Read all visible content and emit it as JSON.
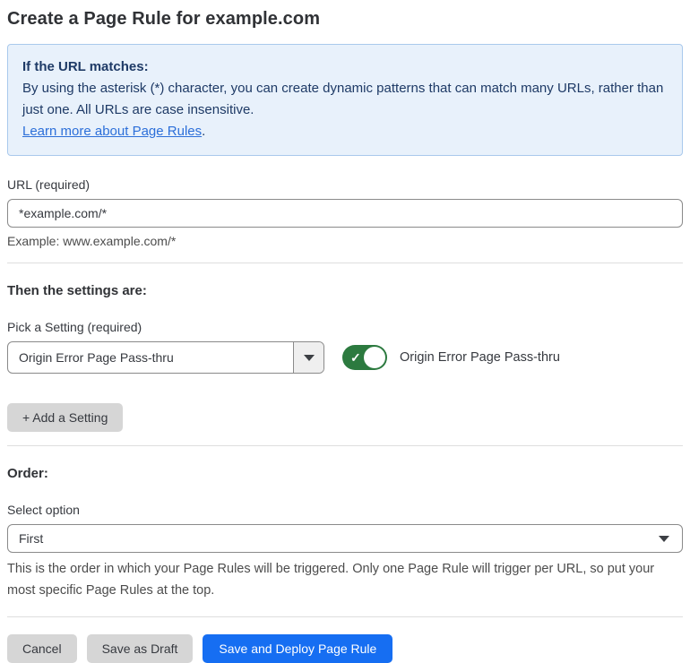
{
  "page": {
    "title": "Create a Page Rule for example.com"
  },
  "info_box": {
    "heading": "If the URL matches:",
    "body": "By using the asterisk (*) character, you can create dynamic patterns that can match many URLs, rather than just one. All URLs are case insensitive.",
    "link_label": "Learn more about Page Rules",
    "link_suffix": "."
  },
  "url_field": {
    "label": "URL (required)",
    "value": "*example.com/*",
    "example": "Example: www.example.com/*"
  },
  "settings_section": {
    "heading": "Then the settings are:",
    "picker_label": "Pick a Setting (required)",
    "picker_value": "Origin Error Page Pass-thru",
    "toggle_state": "on",
    "toggle_check": "✓",
    "toggle_label": "Origin Error Page Pass-thru",
    "add_setting_label": "+ Add a Setting"
  },
  "order_section": {
    "heading": "Order:",
    "select_label": "Select option",
    "select_value": "First",
    "description": "This is the order in which your Page Rules will be triggered. Only one Page Rule will trigger per URL, so put your most specific Page Rules at the top."
  },
  "footer": {
    "cancel_label": "Cancel",
    "save_draft_label": "Save as Draft",
    "save_deploy_label": "Save and Deploy Page Rule"
  },
  "colors": {
    "primary_button_blue": "#166ef2",
    "link_blue": "#2c6fd9",
    "info_box_bg": "#e8f1fb",
    "info_box_border": "#a9c9ec",
    "info_box_text": "#1e3a66",
    "toggle_on_green": "#2c7a3f",
    "gray_button_bg": "#d6d6d6",
    "input_border": "#8a8a8a",
    "divider": "#dedede"
  }
}
